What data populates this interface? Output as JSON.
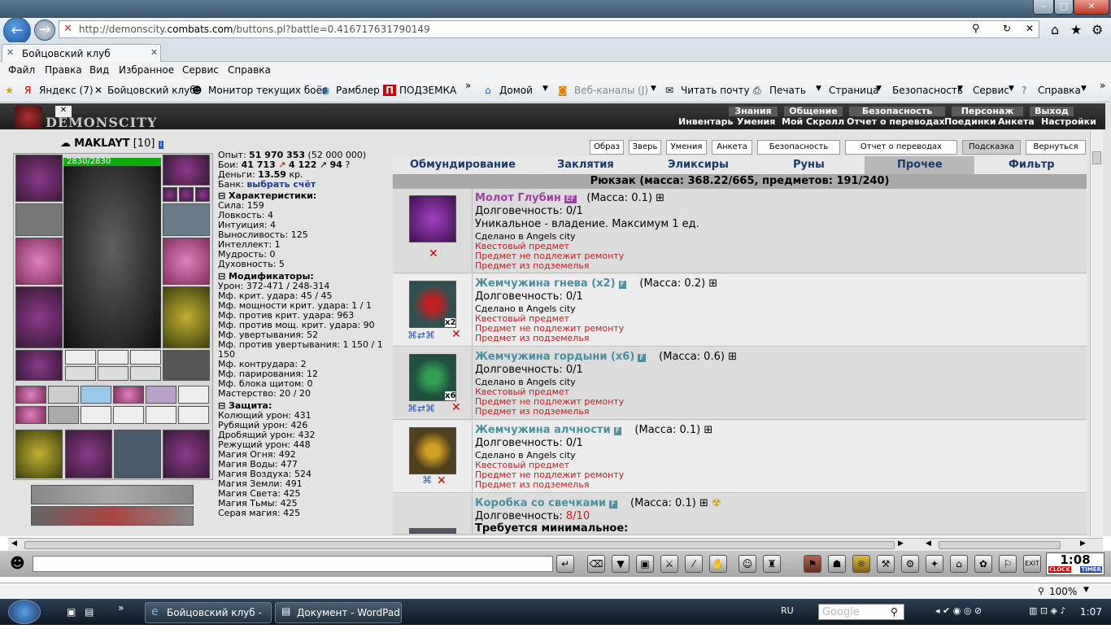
{
  "browser": {
    "url_prefix": "http://demonscity.",
    "url_domain": "combats.com",
    "url_rest": "/buttons.pl?battle=0.416717631790149",
    "tab_title": "Бойцовский клуб",
    "menu": [
      "Файл",
      "Правка",
      "Вид",
      "Избранное",
      "Сервис",
      "Справка"
    ],
    "favorites": [
      "Яндекс (7)",
      "Бойцовский клуб",
      "Монитор текущих боёв",
      "Рамблер",
      "ПОДЗЕМКА"
    ],
    "toolbar": [
      "Домой",
      "Веб-каналы (J)",
      "Читать почту",
      "Печать",
      "Страница",
      "Безопасность",
      "Сервис",
      "Справка"
    ],
    "zoom": "100%"
  },
  "game": {
    "logo": "DEMONSCITY",
    "nav_top": [
      "Знания",
      "Общение",
      "Безопасность",
      "Персонаж",
      "Выход"
    ],
    "nav_bottom": [
      "Инвентарь",
      "Умения",
      "Мой Скролл",
      "Отчет о переводах",
      "Поединки",
      "Анкета",
      "Настройки"
    ],
    "top_buttons": [
      "Образ",
      "Зверь",
      "Умения",
      "Анкета",
      "Безопасность",
      "Отчет о переводах",
      "Подсказка",
      "Вернуться"
    ],
    "character": {
      "name": "MAKLAYT",
      "level": "[10]",
      "hp": "2830/2830"
    },
    "stats": {
      "exp_label": "Опыт:",
      "exp": "51 970 353",
      "exp_next": "(52 000 000)",
      "fights_label": "Бои:",
      "wins": "41 713",
      "losses": "4 122",
      "draws": "94",
      "money_label": "Деньги:",
      "money": "13.59",
      "money_unit": "кр.",
      "bank_label": "Банк:",
      "bank_link": "выбрать счёт",
      "char_header": "Характеристики:",
      "chars": [
        "Сила: 159",
        "Ловкость: 4",
        "Интуиция: 4",
        "Выносливость: 125",
        "Интеллект: 1",
        "Мудрость: 0",
        "Духовность: 5"
      ],
      "mod_header": "Модификаторы:",
      "mods": [
        "Урон: 372-471 / 248-314",
        "Мф. крит. удара: 45 / 45",
        "Мф. мощности крит. удара: 1 / 1",
        "Мф. против крит. удара: 963",
        "Мф. против мощ. крит. удара: 90",
        "Мф. увертывания: 52",
        "Мф. против увертывания: 1 150 / 1",
        "150",
        "Мф. контрудара: 2",
        "Мф. парирования: 12",
        "Мф. блока щитом: 0",
        "Мастерство: 20 / 20"
      ],
      "def_header": "Защита:",
      "defs": [
        "Колющий урон: 431",
        "Рубящий урон: 426",
        "Дробящий урон: 432",
        "Режущий урон: 448",
        "Магия Огня: 492",
        "Магия Воды: 477",
        "Магия Воздуха: 524",
        "Магия Земли: 491",
        "Магия Света: 425",
        "Магия Тьмы: 425",
        "Серая магия: 425"
      ]
    },
    "tabs": [
      "Обмундирование",
      "Заклятия",
      "Эликсиры",
      "Руны",
      "Прочее",
      "Фильтр"
    ],
    "backpack": "Рюкзак (масса: 368.22/665, предметов: 191/240)",
    "items": [
      {
        "name": "Молот Глубин",
        "tag": "EF",
        "mass": "(Масса: 0.1)",
        "dur": "Долговечность: 0/1",
        "extra": "Уникальное - владение. Максимум 1 ед.",
        "made": "Сделано в Angels city",
        "r1": "Квестовый предмет",
        "r2": "Предмет не подлежит ремонту",
        "r3": "Предмет из подземелья"
      },
      {
        "name": "Жемчужина гнева (x2)",
        "tag": "F",
        "mass": "(Масса: 0.2)",
        "dur": "Долговечность: 0/1",
        "count": "x2",
        "made": "Сделано в Angels city",
        "r1": "Квестовый предмет",
        "r2": "Предмет не подлежит ремонту",
        "r3": "Предмет из подземелья"
      },
      {
        "name": "Жемчужина гордыни (x6)",
        "tag": "F",
        "mass": "(Масса: 0.6)",
        "dur": "Долговечность: 0/1",
        "count": "x6",
        "made": "Сделано в Angels city",
        "r1": "Квестовый предмет",
        "r2": "Предмет не подлежит ремонту",
        "r3": "Предмет из подземелья"
      },
      {
        "name": "Жемчужина алчности",
        "tag": "F",
        "mass": "(Масса: 0.1)",
        "dur": "Долговечность: 0/1",
        "made": "Сделано в Angels city",
        "r1": "Квестовый предмет",
        "r2": "Предмет не подлежит ремонту",
        "r3": "Предмет из подземелья"
      },
      {
        "name": "Коробка со свечками",
        "tag": "F",
        "mass": "(Масса: 0.1)",
        "dur_label": "Долговечность:",
        "dur_val": "8/10",
        "req": "Требуется минимальное:"
      }
    ],
    "clock": "1:08",
    "clock_labels": [
      "CLOCK",
      "TIMER"
    ]
  },
  "taskbar": {
    "tasks": [
      "Бойцовский клуб - ...",
      "Документ - WordPad"
    ],
    "lang": "RU",
    "search": "Google",
    "time": "1:07"
  },
  "colors": {
    "accent": "#1a3a6e",
    "item_name": "#4a90a0",
    "warning": "#c02020",
    "hp": "#11aa11"
  }
}
